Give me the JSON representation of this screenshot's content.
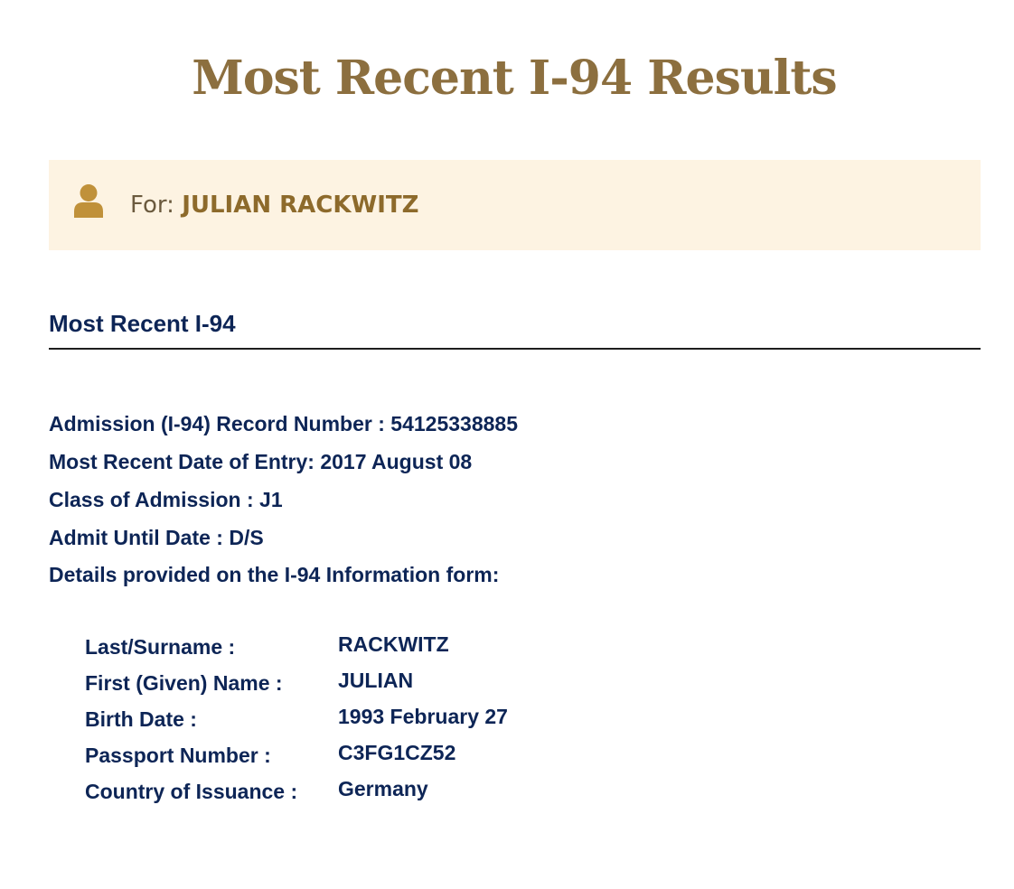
{
  "page_title": "Most Recent I-94 Results",
  "for_banner": {
    "icon": "person-icon",
    "prefix": "For:",
    "name": "JULIAN RACKWITZ"
  },
  "section": {
    "heading": "Most Recent I-94"
  },
  "summary": {
    "record_number": "Admission (I-94) Record Number : 54125338885",
    "entry_date": "Most Recent Date of Entry: 2017 August 08",
    "class_of_admission": "Class of Admission : J1",
    "admit_until": "Admit Until Date : D/S",
    "details_intro": "Details provided on the I-94 Information form:"
  },
  "details": [
    {
      "label": "Last/Surname :",
      "value": "RACKWITZ"
    },
    {
      "label": "First (Given) Name :",
      "value": "JULIAN"
    },
    {
      "label": "Birth Date :",
      "value": "1993 February 27"
    },
    {
      "label": "Passport Number :",
      "value": "C3FG1CZ52"
    },
    {
      "label": "Country of Issuance :",
      "value": "Germany"
    }
  ],
  "colors": {
    "title": "#8c6f3f",
    "banner_bg": "#fdf3e2",
    "icon": "#c0913a",
    "text_navy": "#0d2556"
  }
}
